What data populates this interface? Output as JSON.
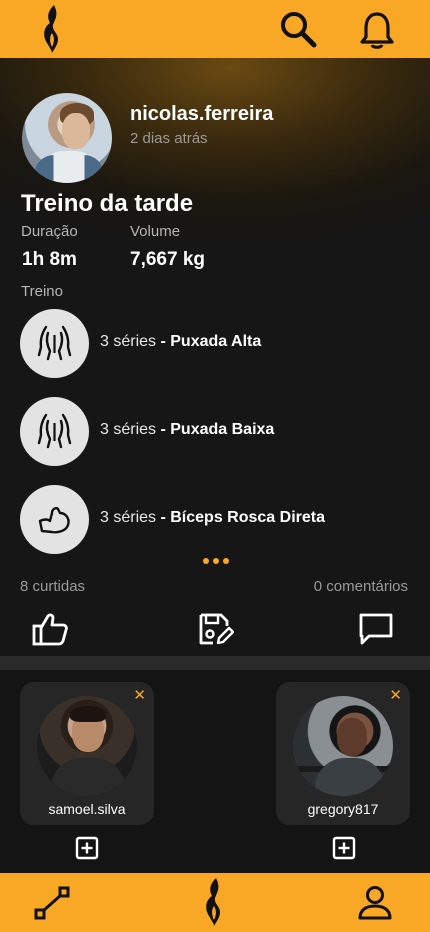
{
  "header": {
    "logo": "flame-logo-icon",
    "search_icon": "search-icon",
    "notification_icon": "bell-icon"
  },
  "post": {
    "username": "nicolas.ferreira",
    "time_ago": "2 dias atrás",
    "title": "Treino da tarde",
    "stats": [
      {
        "label": "Duração",
        "value": "1h 8m"
      },
      {
        "label": "Volume",
        "value": "7,667 kg"
      }
    ],
    "section_label": "Treino",
    "exercises": [
      {
        "sets": "3 séries",
        "separator": " - ",
        "name": "Puxada Alta",
        "icon": "back-muscle-icon"
      },
      {
        "sets": "3 séries",
        "separator": " - ",
        "name": "Puxada Baixa",
        "icon": "back-muscle-icon"
      },
      {
        "sets": "3 séries",
        "separator": " - ",
        "name": "Bíceps Rosca Direta",
        "icon": "bicep-icon"
      }
    ],
    "likes": "8 curtidas",
    "comments": "0 comentários",
    "actions": [
      "like-icon",
      "save-workout-icon",
      "comment-icon"
    ]
  },
  "suggestions": [
    {
      "username": "samoel.silva",
      "close": "✕"
    },
    {
      "username": "gregory817",
      "close": "✕"
    }
  ],
  "nav": {
    "left_icon": "route-icon",
    "center_icon": "flame-logo-icon",
    "right_icon": "profile-icon"
  },
  "colors": {
    "accent": "#F9A825",
    "background": "#141414",
    "card": "#262626",
    "muted": "#9a9a9a"
  }
}
